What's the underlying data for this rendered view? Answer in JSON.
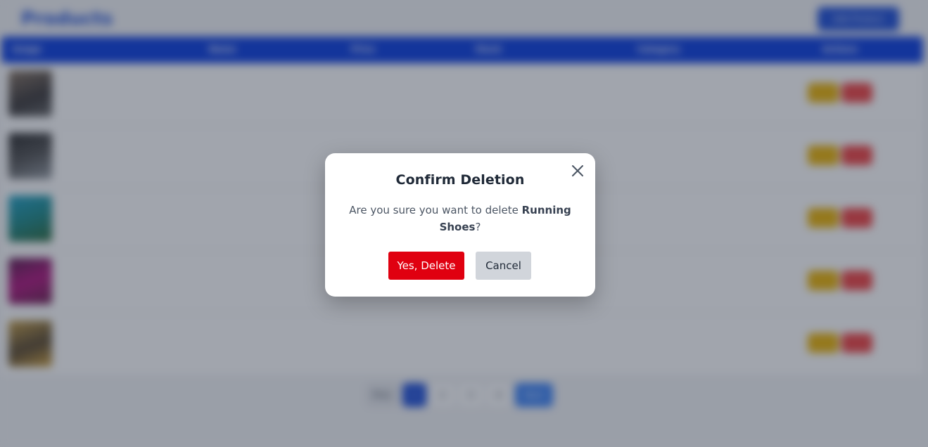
{
  "app": {
    "title": "Products",
    "add_button_label": "Add Product"
  },
  "table": {
    "headers": [
      "Image",
      "Name",
      "Price",
      "Stock",
      "Category",
      "Actions"
    ]
  },
  "pagination": {
    "prev_label": "Prev",
    "pages": [
      "1",
      "2",
      "3",
      "4"
    ],
    "active_page": "1",
    "next_label": "Next"
  },
  "modal": {
    "title": "Confirm Deletion",
    "message_prefix": "Are you sure you want to delete ",
    "item_name": "Running Shoes",
    "message_suffix": "?",
    "confirm_label": "Yes, Delete",
    "cancel_label": "Cancel",
    "close_icon": "close-icon"
  },
  "colors": {
    "confirm": "#e00010",
    "cancel": "#d1d5db",
    "header": "#0b3ee0",
    "edit": "#eab308",
    "delete": "#ef4444"
  }
}
